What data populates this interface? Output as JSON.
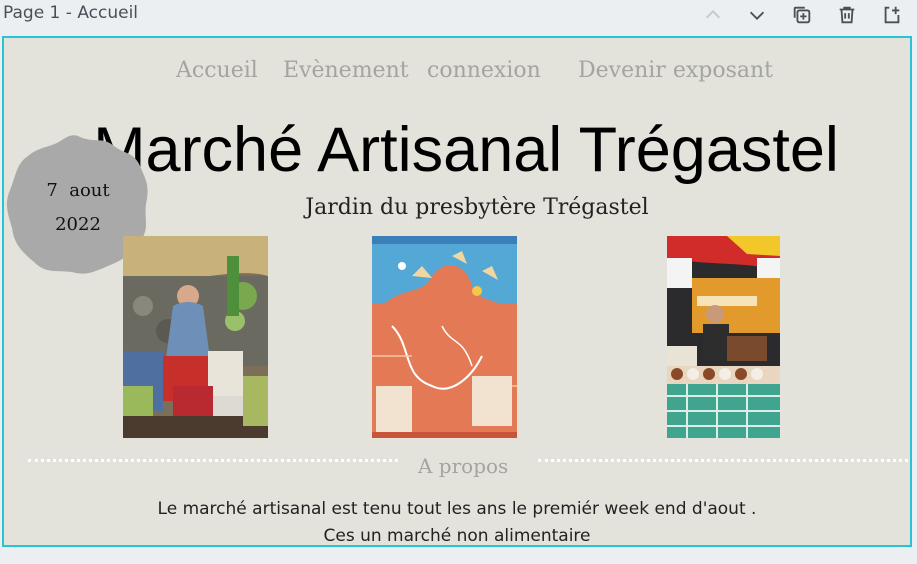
{
  "toolbar": {
    "page_label": "Page 1 - Accueil",
    "icons": [
      "chevron-up-icon",
      "chevron-down-icon",
      "duplicate-icon",
      "trash-icon",
      "add-page-icon"
    ]
  },
  "nav": {
    "items": [
      "Accueil",
      "Evènement",
      "connexion",
      "Devenir exposant"
    ]
  },
  "header": {
    "title": "Marché Artisanal Trégastel",
    "subtitle": "Jardin du presbytère Trégastel"
  },
  "badge": {
    "day": "7  aout",
    "year": "2022"
  },
  "about": {
    "heading": "A propos",
    "line1": "Le marché artisanal est tenu tout les ans le premiér week end d'aout .",
    "line2": "Ces un marché non alimentaire"
  },
  "colors": {
    "selection_border": "#28c4d6",
    "canvas_bg": "#e3e3db",
    "nav_text": "#a4a4a0",
    "badge_fill": "#a9a9a9"
  }
}
